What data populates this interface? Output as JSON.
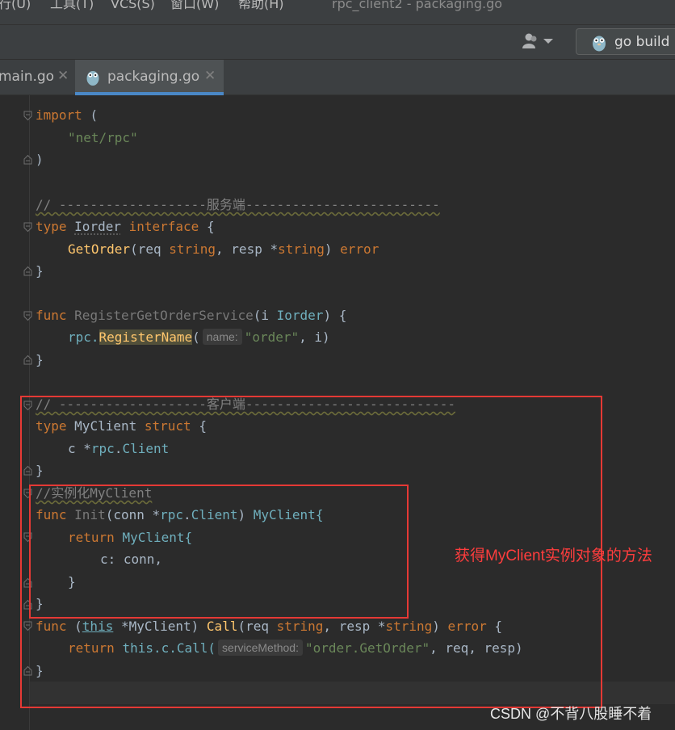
{
  "menu": {
    "items": [
      "行(U)",
      "工具(T)",
      "VCS(S)",
      "窗口(W)",
      "帮助(H)"
    ],
    "window_title": "rpc_client2 - packaging.go"
  },
  "toolbar": {
    "run_config_label": "go build r"
  },
  "tabs": [
    {
      "label": "main.go",
      "active": false
    },
    {
      "label": "packaging.go",
      "active": true
    }
  ],
  "code": {
    "l_import": "import",
    "l_paren_open": "(",
    "l_net_rpc": "\"net/rpc\"",
    "l_paren_close": ")",
    "c_server": "// -------------------服务端-------------------------",
    "l_type": "type",
    "l_iorder": "Iorder",
    "l_interface": "interface",
    "l_brace_open": "{",
    "l_getorder": "GetOrder",
    "l_getorder_params_1": "(req ",
    "l_string": "string",
    "l_getorder_params_2": ", resp *",
    "l_getorder_params_3": ") ",
    "l_error": "error",
    "l_brace_close": "}",
    "l_func": "func",
    "l_register_fn": "RegisterGetOrderService",
    "l_register_params_1": "(i ",
    "l_register_params_2": ") {",
    "l_rpc_dot": "rpc.",
    "l_register_name": "RegisterName",
    "hint_name": "name:",
    "l_order_str": "\"order\"",
    "l_register_args_end": ", i)",
    "c_client": "// -------------------客户端---------------------------",
    "l_myclient": "MyClient",
    "l_struct": "struct",
    "l_field_c": "c *",
    "l_rpc_pkg": "rpc",
    "l_dot": ".",
    "l_client": "Client",
    "c_instantiate": "//实例化MyClient",
    "l_init": "Init",
    "l_init_params": "(conn *",
    "l_init_close": ") ",
    "l_myclient_brace": "MyClient{",
    "l_return": "return",
    "l_c_conn": "c: conn,",
    "l_this": "this",
    "l_call": "Call",
    "l_call_recv_1": " (",
    "l_call_recv_2": " *MyClient) ",
    "l_call_params_1": "(req ",
    "l_call_params_2": ", resp *",
    "l_call_params_3": ") ",
    "l_call_brace": " {",
    "l_this_c_call": "this.c.Call(",
    "hint_service_method": "serviceMethod:",
    "l_order_getorder": "\"order.GetOrder\"",
    "l_call_args_end": ", req, resp)"
  },
  "annotation": {
    "text": "获得MyClient实例对象的方法"
  },
  "watermark": "CSDN @不背八股睡不着",
  "colors": {
    "annotation_red": "#e53935",
    "keyword": "#cc7832",
    "string": "#6a8759",
    "function": "#ffc66d",
    "type": "#6fafbd",
    "comment": "#808080",
    "accent_tab": "#4a88c7"
  }
}
